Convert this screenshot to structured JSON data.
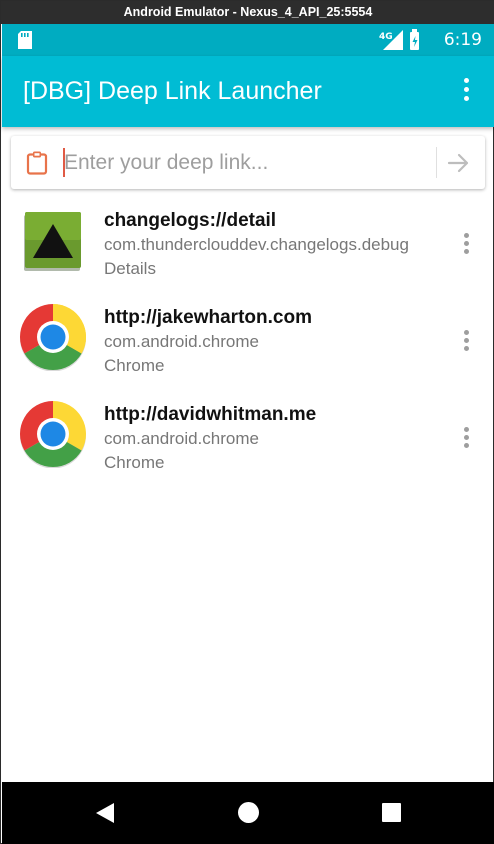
{
  "window": {
    "title": "Android Emulator - Nexus_4_API_25:5554"
  },
  "status_bar": {
    "network": "4G",
    "time": "6:19"
  },
  "app_bar": {
    "title": "[DBG] Deep Link Launcher",
    "overflow_icon": "more-vert-icon"
  },
  "search": {
    "placeholder": "Enter your deep link...",
    "value": "",
    "left_icon": "clipboard-icon",
    "submit_icon": "arrow-right-icon"
  },
  "items": [
    {
      "link": "changelogs://detail",
      "package": "com.thunderclouddev.changelogs.debug",
      "app_name": "Details",
      "icon": "changelogs-app-icon"
    },
    {
      "link": "http://jakewharton.com",
      "package": "com.android.chrome",
      "app_name": "Chrome",
      "icon": "chrome-app-icon"
    },
    {
      "link": "http://davidwhitman.me",
      "package": "com.android.chrome",
      "app_name": "Chrome",
      "icon": "chrome-app-icon"
    }
  ],
  "nav_bar": {
    "back_icon": "back-icon",
    "home_icon": "home-icon",
    "recents_icon": "recents-icon"
  },
  "colors": {
    "status_bar": "#00acc1",
    "app_bar": "#00bcd4",
    "accent": "#e05a45"
  }
}
